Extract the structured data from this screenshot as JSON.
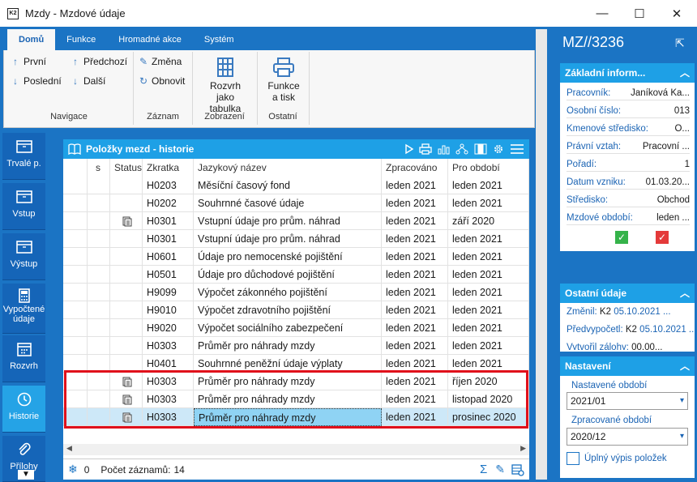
{
  "window": {
    "title": "Mzdy - Mzdové údaje",
    "icon_text": "K2",
    "minimize": "—",
    "maximize": "☐",
    "close": "✕"
  },
  "ribbon": {
    "tabs": [
      "Domů",
      "Funkce",
      "Hromadné akce",
      "Systém"
    ],
    "nav": {
      "first": "První",
      "last": "Poslední",
      "prev": "Předchozí",
      "next": "Další",
      "group": "Navigace"
    },
    "record": {
      "change": "Změna",
      "refresh": "Obnovit",
      "group": "Záznam"
    },
    "display": {
      "schedule": "Rozvrh jako tabulka",
      "group": "Zobrazení"
    },
    "other": {
      "print": "Funkce a tisk",
      "group": "Ostatní"
    }
  },
  "sidenav": [
    {
      "label": "Trvalé p.",
      "icon": "box-icon"
    },
    {
      "label": "Vstup",
      "icon": "box-icon"
    },
    {
      "label": "Výstup",
      "icon": "box-icon"
    },
    {
      "label": "Vypočtené údaje",
      "icon": "calculator-icon"
    },
    {
      "label": "Rozvrh",
      "icon": "calendar-icon"
    },
    {
      "label": "Historie",
      "icon": "clock-icon",
      "active": true
    },
    {
      "label": "Přílohy",
      "icon": "paperclip-icon"
    }
  ],
  "panel": {
    "title": "Položky mezd - historie",
    "record_count_label": "Počet záznamů:",
    "record_count": "14",
    "filter_count": "0"
  },
  "table": {
    "columns": [
      "s",
      "Status",
      "Zkratka",
      "Jazykový název",
      "Zpracováno",
      "Pro období"
    ],
    "rows": [
      {
        "status": "",
        "code": "H0203",
        "name": "Měsíční časový fond",
        "processed": "leden 2021",
        "period": "leden 2021"
      },
      {
        "status": "",
        "code": "H0202",
        "name": "Souhrnné časové údaje",
        "processed": "leden 2021",
        "period": "leden 2021"
      },
      {
        "status": "doc",
        "code": "H0301",
        "name": "Vstupní údaje pro prům. náhrad",
        "processed": "leden 2021",
        "period": "září 2020"
      },
      {
        "status": "",
        "code": "H0301",
        "name": "Vstupní údaje pro prům. náhrad",
        "processed": "leden 2021",
        "period": "leden 2021"
      },
      {
        "status": "",
        "code": "H0601",
        "name": "Údaje pro nemocenské pojištění",
        "processed": "leden 2021",
        "period": "leden 2021"
      },
      {
        "status": "",
        "code": "H0501",
        "name": "Údaje pro důchodové pojištění",
        "processed": "leden 2021",
        "period": "leden 2021"
      },
      {
        "status": "",
        "code": "H9099",
        "name": "Výpočet zákonného pojištění",
        "processed": "leden 2021",
        "period": "leden 2021"
      },
      {
        "status": "",
        "code": "H9010",
        "name": "Výpočet zdravotního pojištění",
        "processed": "leden 2021",
        "period": "leden 2021"
      },
      {
        "status": "",
        "code": "H9020",
        "name": "Výpočet sociálního zabezpečení",
        "processed": "leden 2021",
        "period": "leden 2021"
      },
      {
        "status": "",
        "code": "H0303",
        "name": "Průměr pro náhrady mzdy",
        "processed": "leden 2021",
        "period": "leden 2021"
      },
      {
        "status": "",
        "code": "H0401",
        "name": "Souhrnné peněžní údaje výplaty",
        "processed": "leden 2021",
        "period": "leden 2021"
      },
      {
        "status": "doc",
        "code": "H0303",
        "name": "Průměr pro náhrady mzdy",
        "processed": "leden 2021",
        "period": "říjen 2020"
      },
      {
        "status": "doc",
        "code": "H0303",
        "name": "Průměr pro náhrady mzdy",
        "processed": "leden 2021",
        "period": "listopad 2020"
      },
      {
        "status": "doc",
        "code": "H0303",
        "name": "Průměr pro náhrady mzdy",
        "processed": "leden 2021",
        "period": "prosinec 2020",
        "selected": true
      }
    ]
  },
  "right": {
    "record_id": "MZ//3236",
    "basic": {
      "title": "Základní inform...",
      "fields": [
        {
          "label": "Pracovník:",
          "value": "Janíková Ka..."
        },
        {
          "label": "Osobní číslo:",
          "value": "013"
        },
        {
          "label": "Kmenové středisko:",
          "value": "O..."
        },
        {
          "label": "Právní vztah:",
          "value": "Pracovní ..."
        },
        {
          "label": "Pořadí:",
          "value": "1"
        },
        {
          "label": "Datum vzniku:",
          "value": "01.03.20..."
        },
        {
          "label": "Středisko:",
          "value": "Obchod"
        },
        {
          "label": "Mzdové období:",
          "value": "leden ..."
        }
      ]
    },
    "other": {
      "title": "Ostatní údaje",
      "changed_label": "Změnil:",
      "changed_user": "K2",
      "changed_date": "05.10.2021 ...",
      "precalc_label": "Předvypočetl:",
      "precalc_user": "K2",
      "precalc_date": "05.10.2021 ...",
      "created_label": "Vytvořil zálohy:",
      "created_value": "00.00..."
    },
    "settings": {
      "title": "Nastavení",
      "set_period_label": "Nastavené období",
      "set_period": "2021/01",
      "proc_period_label": "Zpracované období",
      "proc_period": "2020/12",
      "full_list_label": "Úplný výpis položek"
    }
  },
  "colors": {
    "accent": "#1b74c4",
    "header": "#1ea0e6",
    "highlight": "#e0101b",
    "selected": "#8fd3f4"
  }
}
